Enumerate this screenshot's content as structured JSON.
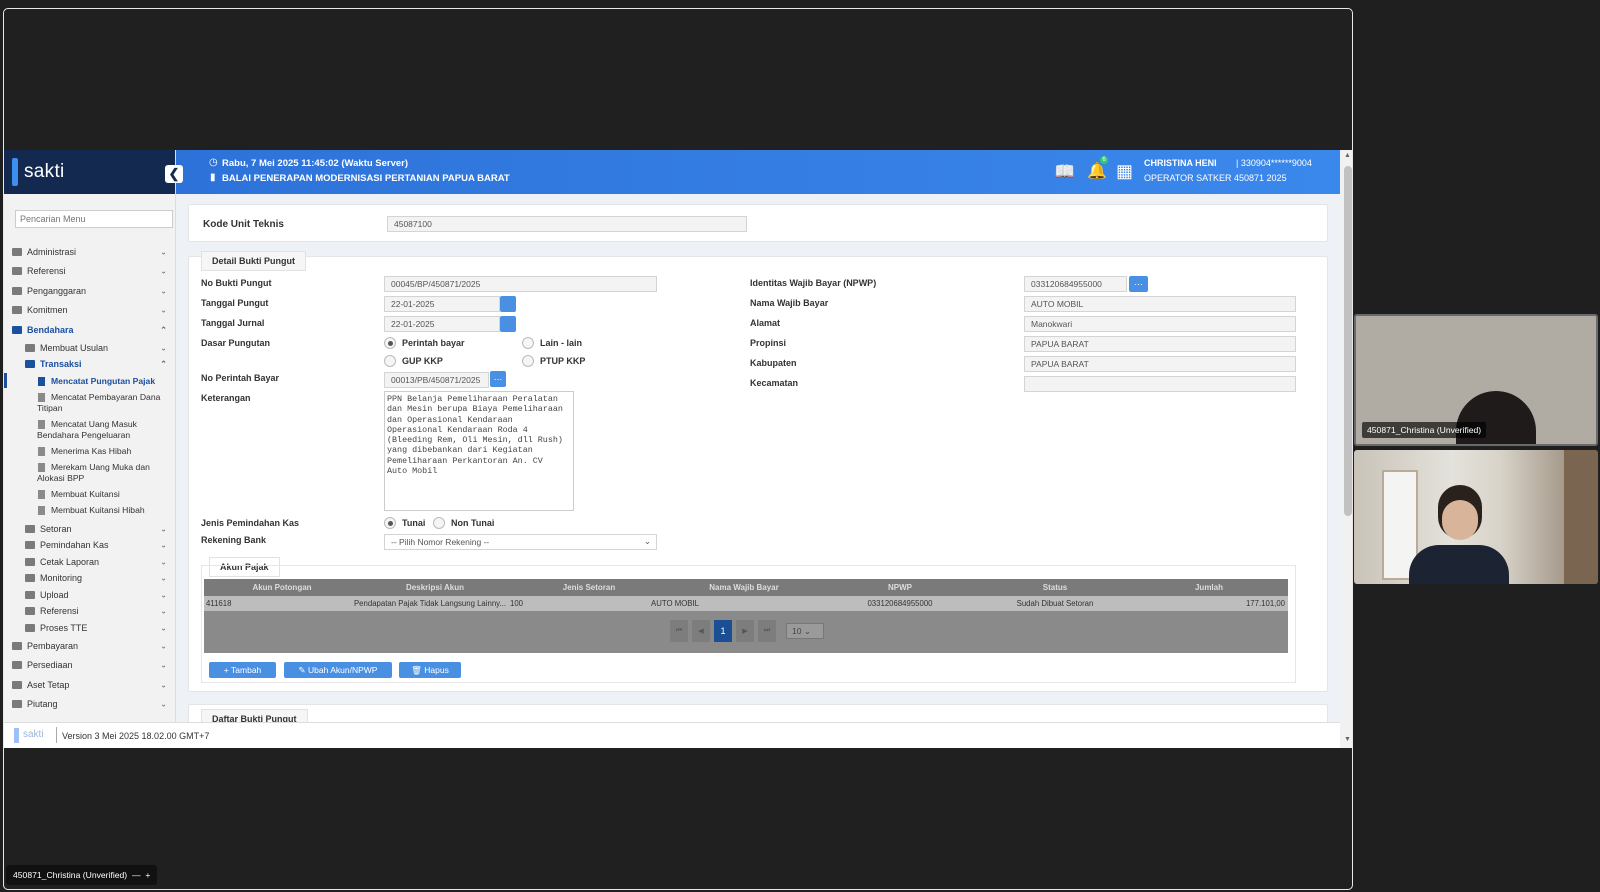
{
  "app": {
    "logo": "sakti",
    "menu_search_placeholder": "Pencarian Menu"
  },
  "topbar": {
    "server_time": "Rabu, 7 Mei 2025 11:45:02 (Waktu Server)",
    "satker_name": "BALAI PENERAPAN MODERNISASI PERTANIAN PAPUA BARAT",
    "user_name": "CHRISTINA HENI",
    "user_nip": "| 330904******9004",
    "user_role": "OPERATOR SATKER 450871 2025",
    "notif_count": "6"
  },
  "sidebar": {
    "items": [
      {
        "label": "Administrasi"
      },
      {
        "label": "Referensi"
      },
      {
        "label": "Penganggaran"
      },
      {
        "label": "Komitmen"
      },
      {
        "label": "Bendahara"
      }
    ],
    "bendahara_children": {
      "membuat_usulan": "Membuat Usulan",
      "transaksi": "Transaksi"
    },
    "transaksi_children": [
      "Mencatat Pungutan Pajak",
      "Mencatat Pembayaran Dana Titipan",
      "Mencatat Uang Masuk Bendahara Pengeluaran",
      "Menerima Kas Hibah",
      "Merekam Uang Muka dan Alokasi BPP",
      "Membuat Kuitansi",
      "Membuat Kuitansi Hibah"
    ],
    "bendahara_rest": [
      "Setoran",
      "Pemindahan Kas",
      "Cetak Laporan",
      "Monitoring",
      "Upload",
      "Referensi",
      "Proses TTE"
    ],
    "bottom_items": [
      "Pembayaran",
      "Persediaan",
      "Aset Tetap",
      "Piutang"
    ]
  },
  "form": {
    "kode_unit_label": "Kode Unit Teknis",
    "kode_unit_value": "45087100",
    "detail_tab": "Detail Bukti Pungut",
    "no_bukti_label": "No Bukti Pungut",
    "no_bukti_value": "00045/BP/450871/2025",
    "tgl_pungut_label": "Tanggal Pungut",
    "tgl_pungut_value": "22-01-2025",
    "tgl_jurnal_label": "Tanggal Jurnal",
    "tgl_jurnal_value": "22-01-2025",
    "dasar_label": "Dasar Pungutan",
    "dasar_opts": [
      "Perintah bayar",
      "Lain - lain",
      "GUP KKP",
      "PTUP KKP"
    ],
    "no_pb_label": "No Perintah Bayar",
    "no_pb_value": "00013/PB/450871/2025",
    "ket_label": "Keterangan",
    "ket_value": "PPN Belanja Pemeliharaan Peralatan\ndan Mesin berupa Biaya Pemeliharaan\ndan Operasional Kendaraan\nOperasional Kendaraan Roda 4\n(Bleeding Rem, Oli Mesin, dll Rush)\nyang dibebankan dari Kegiatan\nPemeliharaan Perkantoran An. CV\nAuto Mobil",
    "jenis_label": "Jenis Pemindahan Kas",
    "jenis_opts": [
      "Tunai",
      "Non Tunai"
    ],
    "rek_label": "Rekening Bank",
    "rek_value": "-- Pilih Nomor Rekening --",
    "npwp_label": "Identitas Wajib Bayar (NPWP)",
    "npwp_value": "033120684955000",
    "nama_label": "Nama Wajib Bayar",
    "nama_value": "AUTO MOBIL",
    "alamat_label": "Alamat",
    "alamat_value": "Manokwari",
    "propinsi_label": "Propinsi",
    "propinsi_value": "PAPUA BARAT",
    "kab_label": "Kabupaten",
    "kab_value": "PAPUA BARAT",
    "kec_label": "Kecamatan",
    "kec_value": ""
  },
  "akun": {
    "tab": "Akun Pajak",
    "headers": [
      "Akun Potongan",
      "Deskripsi Akun",
      "Jenis Setoran",
      "Nama Wajib Bayar",
      "NPWP",
      "Status",
      "Jumlah"
    ],
    "row": [
      "411618",
      "Pendapatan Pajak Tidak Langsung Lainny...",
      "100",
      "AUTO MOBIL",
      "033120684955000",
      "Sudah Dibuat Setoran",
      "177.101,00"
    ],
    "page": "1",
    "page_size": "10",
    "btn_tambah": "Tambah",
    "btn_ubah": "Ubah Akun/NPWP",
    "btn_hapus": "Hapus"
  },
  "daftar_tab": "Daftar Bukti Pungut",
  "footer": {
    "version": "Version 3 Mei 2025 18.02.00 GMT+7"
  },
  "meeting": {
    "tile1": "450871_Christina (Unverified)",
    "tile2": "",
    "bottom_name": "450871_Christina (Unverified)"
  }
}
